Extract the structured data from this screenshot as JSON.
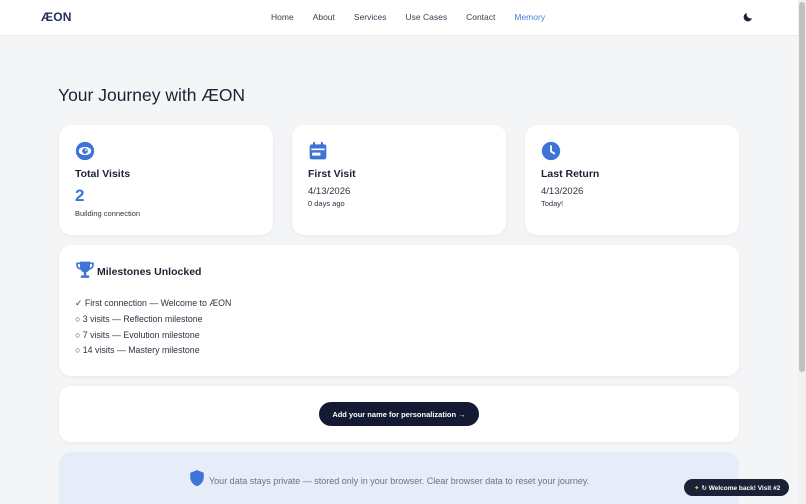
{
  "nav": {
    "logo": "ÆON",
    "links": [
      "Home",
      "About",
      "Services",
      "Use Cases",
      "Contact",
      "Memory"
    ],
    "active_link": "Memory",
    "theme_icon": "moon-icon"
  },
  "page": {
    "title": "Your Journey with ÆON"
  },
  "stats": {
    "total_visits": {
      "icon": "eye-icon",
      "title": "Total Visits",
      "value": "2",
      "sub": "Building connection"
    },
    "first_visit": {
      "icon": "calendar-icon",
      "title": "First Visit",
      "value": "4/13/2026",
      "sub": "0 days ago"
    },
    "last_return": {
      "icon": "clock-icon",
      "title": "Last Return",
      "value": "4/13/2026",
      "sub": "Today!"
    }
  },
  "milestones": {
    "icon": "trophy-icon",
    "title": "Milestones Unlocked",
    "items": [
      "✓ First connection — Welcome to ÆON",
      "○ 3 visits — Reflection milestone",
      "○ 7 visits — Evolution milestone",
      "○ 14 visits — Mastery milestone"
    ]
  },
  "cta": {
    "button_label": "Add your name for personalization →"
  },
  "privacy": {
    "icon": "shield-icon",
    "text": "Your data stays private — stored only in your browser. Clear browser data to reset your journey."
  },
  "toast": {
    "icon": "sparkle-icon",
    "text": "↻ Welcome back! Visit #2"
  },
  "colors": {
    "accent": "#3d74d6",
    "nav_active": "#4a7fd6",
    "button_bg": "#141a33",
    "page_bg": "#f4f5f7",
    "privacy_bg": "#e6ecf8"
  }
}
